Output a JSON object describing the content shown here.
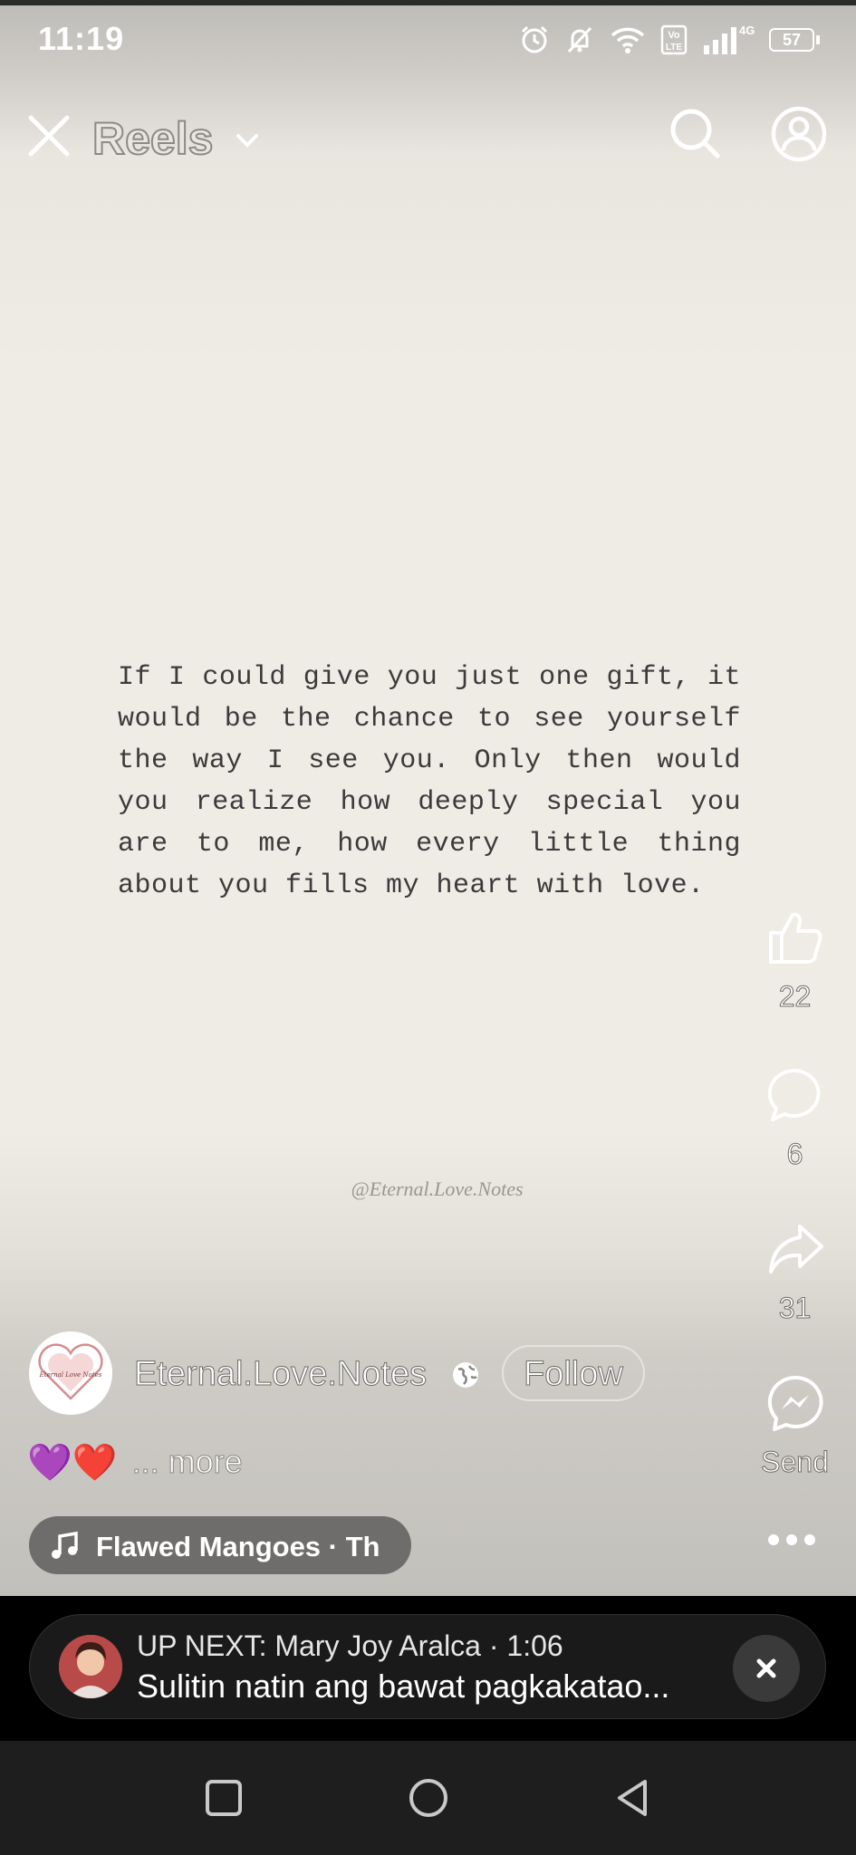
{
  "status_bar": {
    "time": "11:19",
    "battery": "57",
    "network": "4G",
    "volte": "Vo LTE"
  },
  "header": {
    "title": "Reels",
    "icons": [
      "close-icon",
      "chevron-down-icon",
      "search-icon",
      "profile-icon"
    ]
  },
  "reel": {
    "quote": "If I could give you just one gift, it would be the chance to see yourself the way I see you. Only then would you realize how deeply special you are to me, how every little thing about you fills my heart with love.",
    "watermark": "@Eternal.Love.Notes"
  },
  "actions": {
    "like_count": "22",
    "comment_count": "6",
    "share_count": "31",
    "send_label": "Send"
  },
  "author": {
    "name": "Eternal.Love.Notes",
    "follow_label": "Follow",
    "avatar_text": "Eternal Love Notes"
  },
  "caption": {
    "emojis": "💜❤️",
    "more": "... more"
  },
  "music": {
    "label": "Flawed Mangoes · Th"
  },
  "up_next": {
    "prefix": "UP NEXT: Mary Joy Aralca · 1:06",
    "title": "Sulitin natin ang bawat pagkakatao..."
  },
  "colors": {
    "background": "#efebe5",
    "text": "#3b3b3b",
    "overlay_text": "#ffffff",
    "up_next_bg": "#1a1a1a"
  }
}
